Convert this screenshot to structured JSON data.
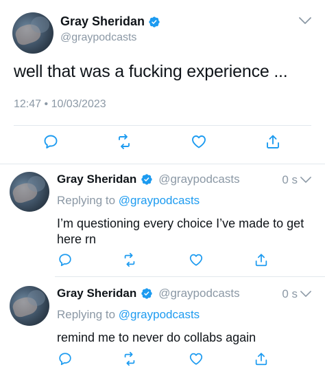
{
  "main_tweet": {
    "author_name": "Gray Sheridan",
    "handle": "@graypodcasts",
    "text": "well that was a fucking experience ...",
    "time": "12:47",
    "separator": "•",
    "date": "10/03/2023",
    "icons": [
      "reply-icon",
      "retweet-icon",
      "like-icon",
      "share-icon",
      "chevron-down-icon",
      "verified-badge-icon"
    ]
  },
  "replies": [
    {
      "author_name": "Gray Sheridan",
      "handle": "@graypodcasts",
      "age": "0 s",
      "replying_prefix": "Replying to",
      "replying_to": "@graypodcasts",
      "text": "I’m questioning every choice I’ve made to get here rn"
    },
    {
      "author_name": "Gray Sheridan",
      "handle": "@graypodcasts",
      "age": "0 s",
      "replying_prefix": "Replying to",
      "replying_to": "@graypodcasts",
      "text": "remind me to never do collabs again"
    }
  ],
  "colors": {
    "accent": "#1d9bf0",
    "secondary_text": "#8b98a5",
    "primary_text": "#0f1419",
    "divider": "#e1e8ed"
  }
}
